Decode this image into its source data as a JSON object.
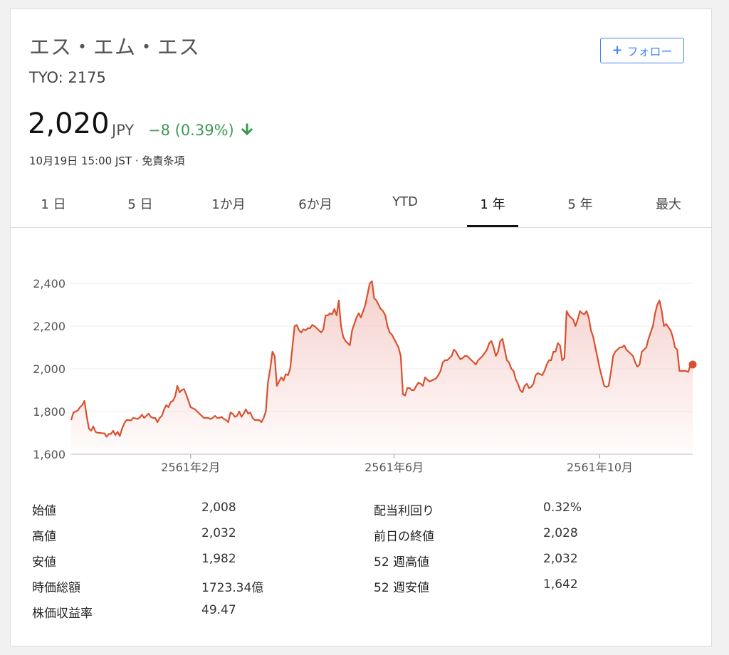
{
  "header": {
    "name": "エス・エム・エス",
    "ticker": "TYO: 2175",
    "follow_label": "フォロー",
    "price": "2,020",
    "currency": "JPY",
    "change": "−8 (0.39%)",
    "change_direction": "down",
    "change_color": "#3c9a53",
    "updated": "10月19日 15:00 JST · 免責条項"
  },
  "tabs": [
    {
      "label": "1 日",
      "active": false
    },
    {
      "label": "5 日",
      "active": false
    },
    {
      "label": "1か月",
      "active": false
    },
    {
      "label": "6か月",
      "active": false
    },
    {
      "label": "YTD",
      "active": false
    },
    {
      "label": "1 年",
      "active": true
    },
    {
      "label": "5 年",
      "active": false
    },
    {
      "label": "最大",
      "active": false
    }
  ],
  "chart_data": {
    "type": "area",
    "line_color": "#d9502f",
    "fill_color": "#f3c5c0",
    "ylim": [
      1600,
      2450
    ],
    "y_ticks": [
      1600,
      1800,
      2000,
      2200,
      2400
    ],
    "y_tick_labels": [
      "1,600",
      "1,800",
      "2,000",
      "2,200",
      "2,400"
    ],
    "x_tick_labels": [
      "2561年2月",
      "2561年6月",
      "2561年10月"
    ],
    "x_tick_index": [
      54,
      146,
      239
    ],
    "grid": true,
    "values": [
      1760,
      1795,
      1800,
      1805,
      1820,
      1830,
      1850,
      1780,
      1720,
      1710,
      1730,
      1705,
      1700,
      1700,
      1698,
      1698,
      1682,
      1695,
      1695,
      1710,
      1690,
      1705,
      1685,
      1720,
      1745,
      1760,
      1760,
      1758,
      1770,
      1768,
      1765,
      1772,
      1785,
      1770,
      1780,
      1790,
      1775,
      1770,
      1770,
      1750,
      1770,
      1780,
      1810,
      1830,
      1820,
      1845,
      1850,
      1870,
      1920,
      1890,
      1900,
      1905,
      1880,
      1850,
      1820,
      1815,
      1810,
      1800,
      1790,
      1780,
      1770,
      1770,
      1770,
      1765,
      1770,
      1780,
      1770,
      1770,
      1775,
      1765,
      1760,
      1750,
      1795,
      1790,
      1775,
      1780,
      1800,
      1775,
      1790,
      1810,
      1790,
      1795,
      1770,
      1760,
      1760,
      1760,
      1750,
      1770,
      1800,
      1940,
      2000,
      2080,
      2060,
      1920,
      1940,
      1960,
      1945,
      1975,
      1970,
      2000,
      2100,
      2200,
      2205,
      2180,
      2170,
      2185,
      2180,
      2190,
      2190,
      2205,
      2200,
      2190,
      2180,
      2170,
      2185,
      2250,
      2250,
      2260,
      2255,
      2280,
      2250,
      2320,
      2200,
      2150,
      2130,
      2120,
      2110,
      2180,
      2210,
      2240,
      2260,
      2240,
      2270,
      2300,
      2350,
      2400,
      2410,
      2330,
      2320,
      2300,
      2280,
      2270,
      2250,
      2200,
      2170,
      2160,
      2140,
      2120,
      2100,
      2060,
      1880,
      1875,
      1910,
      1910,
      1900,
      1900,
      1920,
      1935,
      1930,
      1920,
      1960,
      1950,
      1940,
      1945,
      1950,
      1955,
      1970,
      1990,
      2030,
      2040,
      2040,
      2050,
      2060,
      2090,
      2080,
      2060,
      2045,
      2050,
      2060,
      2060,
      2050,
      2040,
      2030,
      2020,
      2040,
      2050,
      2060,
      2075,
      2090,
      2120,
      2130,
      2100,
      2060,
      2080,
      2130,
      2140,
      2090,
      2040,
      2030,
      2000,
      1990,
      1950,
      1930,
      1900,
      1890,
      1920,
      1930,
      1910,
      1915,
      1930,
      1970,
      1980,
      1975,
      1970,
      1990,
      2020,
      2040,
      2040,
      2080,
      2080,
      2120,
      2110,
      2040,
      2050,
      2270,
      2250,
      2240,
      2230,
      2200,
      2230,
      2270,
      2260,
      2255,
      2270,
      2240,
      2180,
      2150,
      2100,
      2050,
      2000,
      1960,
      1920,
      1915,
      1920,
      1980,
      2060,
      2080,
      2090,
      2100,
      2100,
      2110,
      2090,
      2080,
      2070,
      2060,
      2030,
      2010,
      2020,
      2080,
      2090,
      2100,
      2140,
      2170,
      2200,
      2260,
      2300,
      2320,
      2270,
      2200,
      2210,
      2195,
      2180,
      2150,
      2100,
      2090,
      1990,
      1990,
      1990,
      1990,
      1985,
      2020,
      2020
    ]
  },
  "stats": {
    "left": [
      {
        "label": "始値",
        "value": "2,008"
      },
      {
        "label": "高値",
        "value": "2,032"
      },
      {
        "label": "安値",
        "value": "1,982"
      },
      {
        "label": "時価総額",
        "value": "1723.34億"
      },
      {
        "label": "株価収益率",
        "value": "49.47"
      }
    ],
    "right": [
      {
        "label": "配当利回り",
        "value": "0.32%"
      },
      {
        "label": "前日の終値",
        "value": "2,028"
      },
      {
        "label": "52 週高値",
        "value": "2,032"
      },
      {
        "label": "52 週安値",
        "value": "1,642"
      }
    ]
  }
}
